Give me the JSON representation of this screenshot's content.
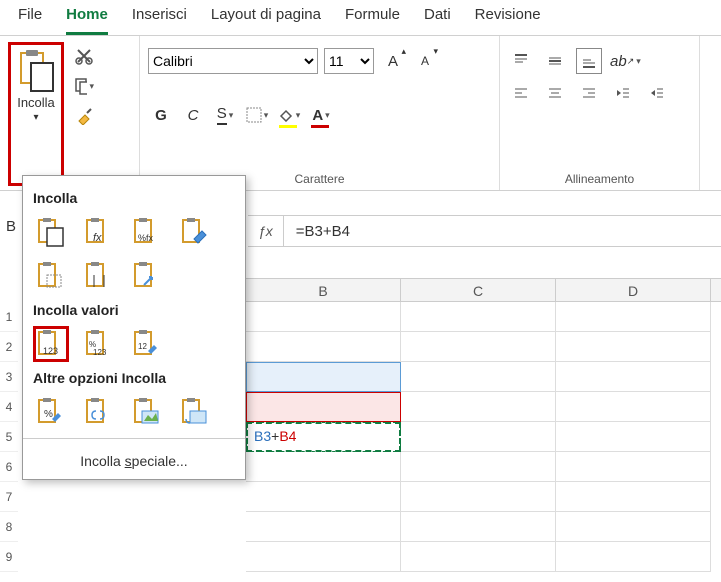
{
  "tabs": [
    "File",
    "Home",
    "Inserisci",
    "Layout di pagina",
    "Formule",
    "Dati",
    "Revisione"
  ],
  "active_tab": "Home",
  "clipboard": {
    "paste_label": "Incolla"
  },
  "font": {
    "name": "Calibri",
    "size": "11",
    "bold": "G",
    "italic": "C",
    "underline": "S",
    "group_label": "Carattere"
  },
  "alignment": {
    "group_label": "Allineamento"
  },
  "paste_menu": {
    "h1": "Incolla",
    "h2": "Incolla valori",
    "h3": "Altre opzioni Incolla",
    "special_pre": "Incolla ",
    "special_u": "s",
    "special_post": "peciale..."
  },
  "cell_ref_partial": "B",
  "formula": "=B3+B4",
  "columns": [
    "B",
    "C",
    "D"
  ],
  "row_numbers": [
    "1",
    "2",
    "3",
    "4",
    "5",
    "6",
    "7",
    "8",
    "9"
  ],
  "cells": {
    "b5_prefix": "3",
    "b5_mid": "+",
    "b5_ref1": "B3",
    "b5_ref2": "B4"
  }
}
